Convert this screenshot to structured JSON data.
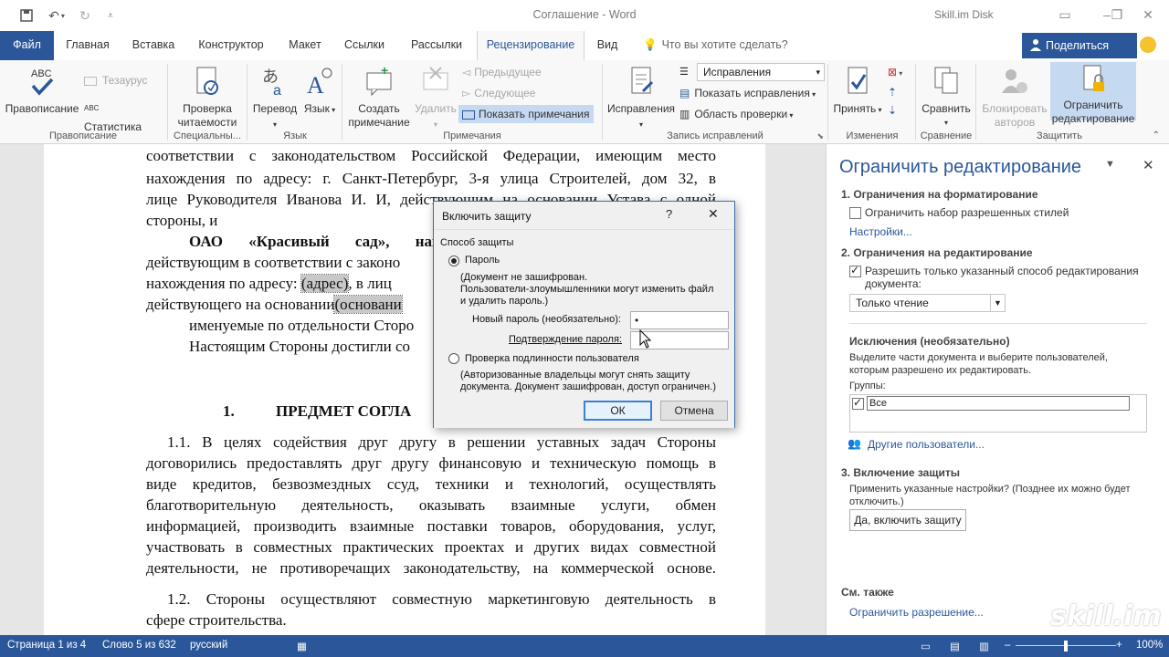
{
  "window": {
    "title": "Соглашение  -  Word",
    "account": "Skill.im Disk"
  },
  "tabs": [
    {
      "label": "Файл"
    },
    {
      "label": "Главная"
    },
    {
      "label": "Вставка"
    },
    {
      "label": "Конструктор"
    },
    {
      "label": "Макет"
    },
    {
      "label": "Ссылки"
    },
    {
      "label": "Рассылки"
    },
    {
      "label": "Рецензирование"
    },
    {
      "label": "Вид"
    }
  ],
  "tell_me": "Что вы хотите сделать?",
  "share_label": "Поделиться",
  "ribbon": {
    "spelling": "Правописание",
    "thesaurus": "Тезаурус",
    "statistics": "Статистика",
    "g_proofing": "Правописание",
    "readability_1": "Проверка",
    "readability_2": "читаемости",
    "g_special": "Специальны...",
    "translate": "Перевод",
    "language": "Язык",
    "g_language": "Язык",
    "new_comment_1": "Создать",
    "new_comment_2": "примечание",
    "delete": "Удалить",
    "previous": "Предыдущее",
    "next": "Следующее",
    "show_comments": "Показать примечания",
    "g_comments": "Примечания",
    "track_changes": "Исправления",
    "markup_select": "Исправления",
    "show_markup": "Показать исправления",
    "review_pane": "Область проверки",
    "g_tracking": "Запись исправлений",
    "accept": "Принять",
    "g_changes": "Изменения",
    "compare": "Сравнить",
    "g_compare": "Сравнение",
    "block_1": "Блокировать",
    "block_2": "авторов",
    "restrict_1": "Ограничить",
    "restrict_2": "редактирование",
    "g_protect": "Защитить"
  },
  "document": {
    "lines": [
      "соответствии с законодательством Российской Федерации, имеющим место",
      "нахождения по адресу: г. Санкт-Петербург, 3-я улица Строителей, дом 32, в",
      "лице Руководителя Иванова И. И, действующим на основании Устава с одной",
      "стороны, и",
      "ОАО «Красивый сад», нах",
      "действующим в соответствии с законо",
      "нахождения по адресу:",
      "(адрес)",
      ", в лиц",
      "действующего на основании",
      "(основани",
      "именуемые по отдельности Сторо",
      "Настоящим Стороны достигли со",
      "1.",
      "ПРЕДМЕТ СОГЛА",
      "1.1. В целях содействия друг другу в решении уставных задач Стороны",
      "договорились предоставлять друг другу финансовую и техническую помощь в",
      "виде кредитов, безвозмездных ссуд, техники и технологий, осуществлять",
      "благотворительную деятельность, оказывать взаимные услуги, обмен",
      "информацией, производить взаимные поставки товаров, оборудования, услуг,",
      "участвовать в совместных практических проектах и других видах совместной",
      "деятельности, не противоречащих законодательству, на коммерческой основе.",
      "1.2. Стороны осуществляют совместную маркетинговую деятельность в",
      "сфере строительства."
    ]
  },
  "dialog": {
    "title": "Включить защиту",
    "help": "?",
    "close": "✕",
    "group_label": "Способ защиты",
    "password_option": "Пароль",
    "password_desc_1": "(Документ не зашифрован.",
    "password_desc_2": "Пользователи-злоумышленники могут изменить файл",
    "password_desc_3": "и удалить пароль.)",
    "new_password_label": "Новый пароль (необязательно):",
    "new_password_value": "•",
    "confirm_label": "Подтверждение пароля:",
    "confirm_value": "",
    "auth_option": "Проверка подлинности пользователя",
    "auth_desc_1": "(Авторизованные владельцы могут снять защиту",
    "auth_desc_2": "документа. Документ зашифрован, доступ ограничен.)",
    "ok": "ОК",
    "cancel": "Отмена"
  },
  "pane": {
    "title": "Ограничить редактирование",
    "s1_title": "1. Ограничения на форматирование",
    "s1_checkbox": "Ограничить набор разрешенных стилей",
    "s1_link": "Настройки...",
    "s2_title": "2. Ограничения на редактирование",
    "s2_checkbox_1": "Разрешить только указанный способ редактирования",
    "s2_checkbox_2": "документа:",
    "s2_select": "Только чтение",
    "exc_title": "Исключения (необязательно)",
    "exc_desc_1": "Выделите части документа и выберите пользователей,",
    "exc_desc_2": "которым разрешено их редактировать.",
    "groups_label": "Группы:",
    "group_all": "Все",
    "other_users": "Другие пользователи...",
    "s3_title": "3. Включение защиты",
    "s3_desc_1": "Применить указанные настройки? (Позднее их можно будет",
    "s3_desc_2": "отключить.)",
    "s3_button": "Да, включить защиту",
    "see_also": "См. также",
    "restrict_permission": "Ограничить разрешение..."
  },
  "status": {
    "page": "Страница 1 из 4",
    "words": "Слово 5 из 632",
    "language": "русский",
    "zoom": "100%"
  },
  "watermark": "skill.im",
  "colors": {
    "accent": "#2b579a"
  }
}
